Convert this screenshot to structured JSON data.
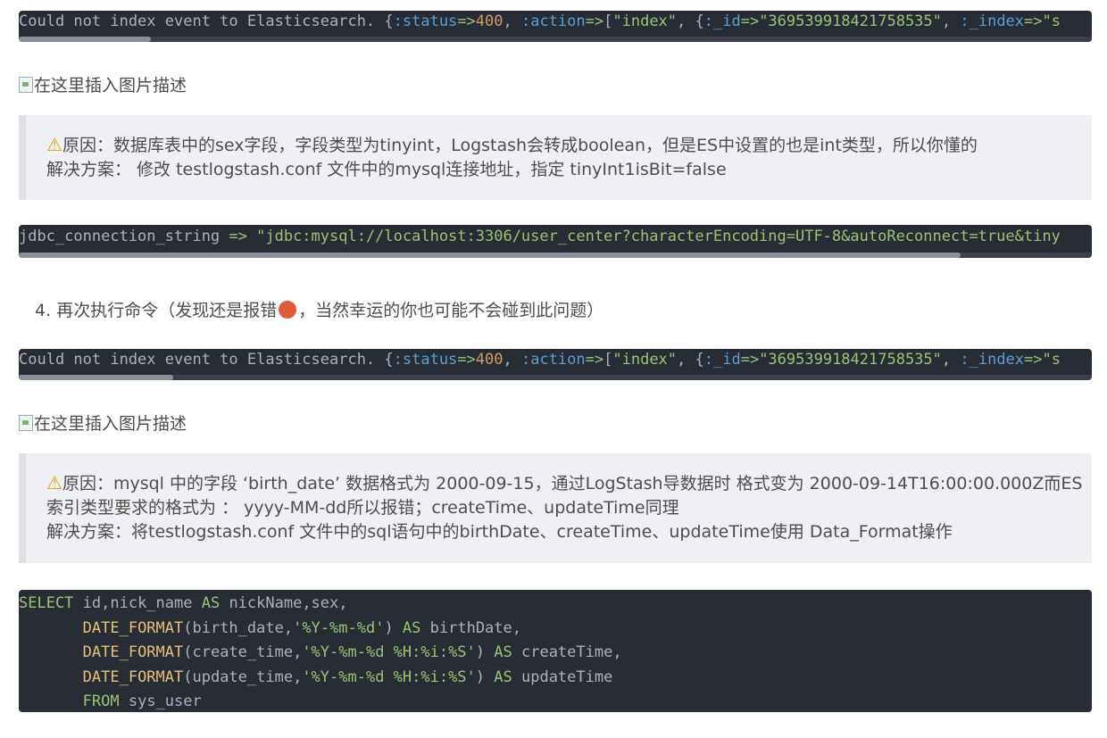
{
  "code1": {
    "segments": [
      {
        "t": "Could not index event to Elasticsearch. {",
        "c": "c-key"
      },
      {
        "t": ":status",
        "c": "c-sym"
      },
      {
        "t": "=>",
        "c": "c-op"
      },
      {
        "t": "400",
        "c": "c-num"
      },
      {
        "t": ", ",
        "c": "c-key"
      },
      {
        "t": ":action",
        "c": "c-sym"
      },
      {
        "t": "=>",
        "c": "c-op"
      },
      {
        "t": "[",
        "c": "c-key"
      },
      {
        "t": "\"index\"",
        "c": "c-str"
      },
      {
        "t": ", {",
        "c": "c-key"
      },
      {
        "t": ":_id",
        "c": "c-sym"
      },
      {
        "t": "=>",
        "c": "c-op"
      },
      {
        "t": "\"369539918421758535\"",
        "c": "c-str"
      },
      {
        "t": ", ",
        "c": "c-key"
      },
      {
        "t": ":_index",
        "c": "c-sym"
      },
      {
        "t": "=>",
        "c": "c-op"
      },
      {
        "t": "\"s",
        "c": "c-str"
      }
    ]
  },
  "img_alt_1": "在这里插入图片描述",
  "quote1": {
    "warn_icon": "⚠",
    "line1": "原因：数据库表中的sex字段，字段类型为tinyint，Logstash会转成boolean，但是ES中设置的也是int类型，所以你懂的",
    "line2": "解决方案： 修改 testlogstash.conf 文件中的mysql连接地址，指定 tinyInt1isBit=false"
  },
  "code2": {
    "segments": [
      {
        "t": "jdbc_connection_string ",
        "c": "c-key"
      },
      {
        "t": "=>",
        "c": "c-op"
      },
      {
        "t": " \"jdbc:mysql://localhost:3306/user_center?characterEncoding=UTF-8&autoReconnect=true&tiny",
        "c": "c-str"
      }
    ]
  },
  "step4": {
    "number": "4.",
    "text_before": "再次执行命令（发现还是报错",
    "text_after": "，当然幸运的你也可能不会碰到此问题）"
  },
  "code3": {
    "segments": [
      {
        "t": "Could not index event to Elasticsearch. {",
        "c": "c-key"
      },
      {
        "t": ":status",
        "c": "c-sym"
      },
      {
        "t": "=>",
        "c": "c-op"
      },
      {
        "t": "400",
        "c": "c-num"
      },
      {
        "t": ", ",
        "c": "c-key"
      },
      {
        "t": ":action",
        "c": "c-sym"
      },
      {
        "t": "=>",
        "c": "c-op"
      },
      {
        "t": "[",
        "c": "c-key"
      },
      {
        "t": "\"index\"",
        "c": "c-str"
      },
      {
        "t": ", {",
        "c": "c-key"
      },
      {
        "t": ":_id",
        "c": "c-sym"
      },
      {
        "t": "=>",
        "c": "c-op"
      },
      {
        "t": "\"369539918421758535\"",
        "c": "c-str"
      },
      {
        "t": ", ",
        "c": "c-key"
      },
      {
        "t": ":_index",
        "c": "c-sym"
      },
      {
        "t": "=>",
        "c": "c-op"
      },
      {
        "t": "\"s",
        "c": "c-str"
      }
    ]
  },
  "img_alt_2": "在这里插入图片描述",
  "quote2": {
    "warn_icon": "⚠",
    "line1": "原因：mysql 中的字段 ‘birth_date’ 数据格式为 2000-09-15，通过LogStash导数据时 格式变为 2000-09-14T16:00:00.000Z而ES",
    "line2": "索引类型要求的格式为 ： yyyy-MM-dd所以报错；createTime、updateTime同理",
    "line3": "解决方案：将testlogstash.conf 文件中的sql语句中的birthDate、createTime、updateTime使用 Data_Format操作"
  },
  "sql": {
    "lines": [
      [
        {
          "t": "SELECT",
          "c": "kw"
        },
        {
          "t": " id,nick_name ",
          "c": "c-key"
        },
        {
          "t": "AS",
          "c": "kw"
        },
        {
          "t": " nickName,sex,",
          "c": "c-key"
        }
      ],
      [
        {
          "t": "       ",
          "c": "c-key"
        },
        {
          "t": "DATE_FORMAT",
          "c": "fn"
        },
        {
          "t": "(birth_date,",
          "c": "c-key"
        },
        {
          "t": "'%Y-%m-%d'",
          "c": "sq"
        },
        {
          "t": ") ",
          "c": "c-key"
        },
        {
          "t": "AS",
          "c": "kw"
        },
        {
          "t": " birthDate,",
          "c": "c-key"
        }
      ],
      [
        {
          "t": "       ",
          "c": "c-key"
        },
        {
          "t": "DATE_FORMAT",
          "c": "fn"
        },
        {
          "t": "(create_time,",
          "c": "c-key"
        },
        {
          "t": "'%Y-%m-%d %H:%i:%S'",
          "c": "sq"
        },
        {
          "t": ") ",
          "c": "c-key"
        },
        {
          "t": "AS",
          "c": "kw"
        },
        {
          "t": " createTime,",
          "c": "c-key"
        }
      ],
      [
        {
          "t": "       ",
          "c": "c-key"
        },
        {
          "t": "DATE_FORMAT",
          "c": "fn"
        },
        {
          "t": "(update_time,",
          "c": "c-key"
        },
        {
          "t": "'%Y-%m-%d %H:%i:%S'",
          "c": "sq"
        },
        {
          "t": ") ",
          "c": "c-key"
        },
        {
          "t": "AS",
          "c": "kw"
        },
        {
          "t": " updateTime",
          "c": "c-key"
        }
      ],
      [
        {
          "t": "       ",
          "c": "c-key"
        },
        {
          "t": "FROM",
          "c": "kw"
        },
        {
          "t": " sys_user",
          "c": "c-key"
        }
      ]
    ]
  }
}
